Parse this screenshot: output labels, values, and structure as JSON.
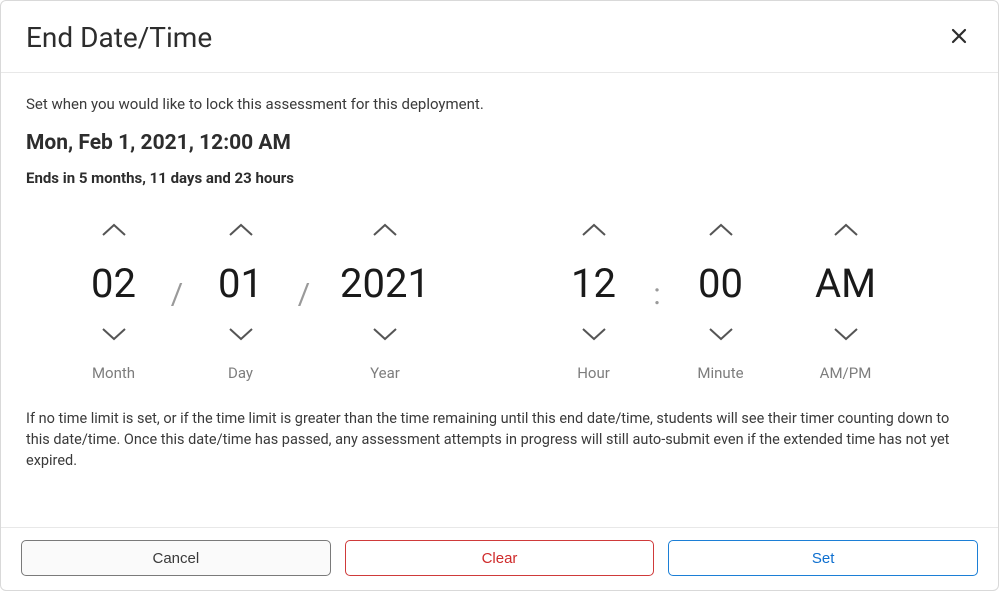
{
  "header": {
    "title": "End Date/Time",
    "close_icon": "×"
  },
  "description": "Set when you would like to lock this assessment for this deployment.",
  "selected_datetime": "Mon, Feb 1, 2021, 12:00 AM",
  "relative_text": "Ends in 5 months, 11 days and 23 hours",
  "picker": {
    "month": {
      "value": "02",
      "label": "Month"
    },
    "day": {
      "value": "01",
      "label": "Day"
    },
    "year": {
      "value": "2021",
      "label": "Year"
    },
    "hour": {
      "value": "12",
      "label": "Hour"
    },
    "minute": {
      "value": "00",
      "label": "Minute"
    },
    "ampm": {
      "value": "AM",
      "label": "AM/PM"
    },
    "separators": {
      "slash": "/",
      "colon": ":"
    }
  },
  "note": "If no time limit is set, or if the time limit is greater than the time remaining until this end date/time, students will see their timer counting down to this date/time. Once this date/time has passed, any assessment attempts in progress will still auto-submit even if the extended time has not yet expired.",
  "footer": {
    "cancel": "Cancel",
    "clear": "Clear",
    "set": "Set"
  }
}
